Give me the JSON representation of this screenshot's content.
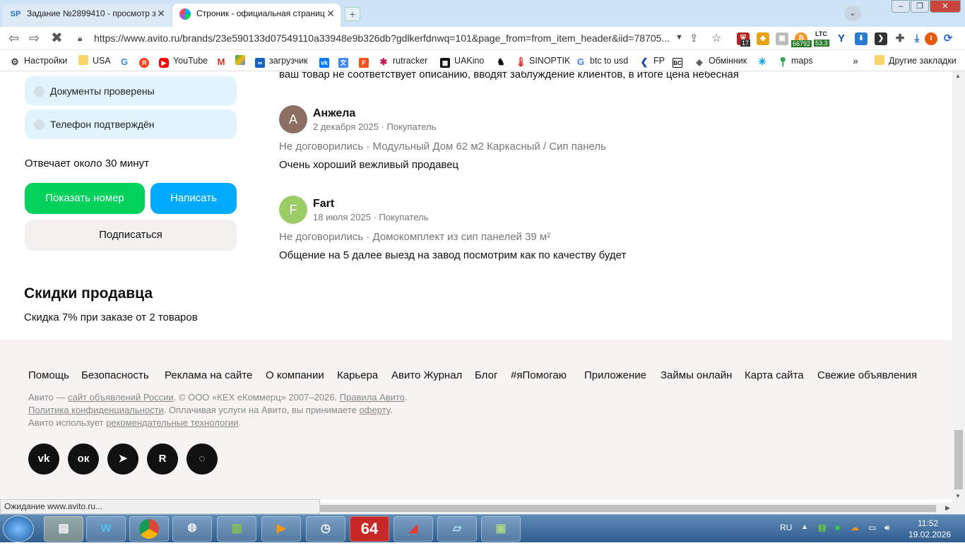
{
  "browser": {
    "tabs": [
      {
        "favicon": "SP",
        "title": "Задание №2899410 - просмотр з"
      },
      {
        "favicon": "avito",
        "title": "Строник - официальная страниц"
      }
    ],
    "url": "https://www.avito.ru/brands/23e590133d07549110a33948e9b326db?gdlkerfdnwq=101&page_from=from_item_header&iid=78705...",
    "extensions": {
      "badge_17": "17",
      "price_1": "66792",
      "ltc_label": "LTC",
      "ltc_value": "53.3",
      "profile_letter": "I"
    },
    "bookmarks": [
      "Настройки",
      "USA",
      "YouTube",
      "загрузчик",
      "rutracker",
      "UAKino",
      "SINOPTIK",
      "btc to usd",
      "FP",
      "Обмінник",
      "maps"
    ],
    "bookmarks_more": "»",
    "other_bookmarks": "Другие закладки"
  },
  "seller": {
    "chips": [
      "Документы проверены",
      "Телефон подтверждён"
    ],
    "response_time": "Отвечает около 30 минут",
    "show_number": "Показать номер",
    "write": "Написать",
    "subscribe": "Подписаться",
    "discounts_title": "Скидки продавца",
    "discount_text": "Скидка 7% при заказе от 2 товаров"
  },
  "reviews": {
    "truncated_text": "ваш товар не соответствует описанию, вводят заблуждение клиентов, в итоге цена небесная",
    "items": [
      {
        "initial": "А",
        "name": "Анжела",
        "meta": "2 декабря 2025 · Покупатель",
        "deal": "Не договорились · Модульный Дом 62 м2 Каркасный / Сип панель",
        "text": "Очень хороший вежливый продавец"
      },
      {
        "initial": "F",
        "name": "Fart",
        "meta": "18 июля 2025 · Покупатель",
        "deal": "Не договорились · Домокомплект из сип панелей 39 м²",
        "text": "Общение на 5 далее выезд на завод посмотрим как по качеству будет"
      }
    ]
  },
  "footer": {
    "links": [
      "Помощь",
      "Безопасность",
      "Реклама на сайте",
      "О компании",
      "Карьера",
      "Авито Журнал",
      "Блог",
      "#яПомогаю",
      "Приложение",
      "Займы онлайн",
      "Карта сайта",
      "Свежие объявления"
    ],
    "line1_a": "Авито — ",
    "line1_link1": "сайт объявлений России",
    "line1_b": ". © ООО «КЕХ еКоммерц» 2007–2026. ",
    "line1_link2": "Правила Авито",
    "line1_c": ".",
    "line2_link1": "Политика конфиденциальности",
    "line2_b": ". Оплачивая услуги на Авито, вы принимаете ",
    "line2_link2": "оферту",
    "line2_c": ".",
    "line3_a": "Авито использует ",
    "line3_link": "рекомендательные технологии",
    "line3_c": ".",
    "social": [
      "vk-icon",
      "ok-icon",
      "telegram-icon",
      "rutube-icon",
      "max-icon"
    ]
  },
  "status_text": "Ожидание www.avito.ru...",
  "taskbar": {
    "lang": "RU",
    "time": "11:52",
    "date": "19.02.2026",
    "app_64": "64"
  },
  "colors": {
    "green": "#02d15c",
    "blue": "#00aaff",
    "chip_bg": "#e1f3fd",
    "avatar_a": "#8d6e63",
    "avatar_f": "#9ccc65"
  }
}
